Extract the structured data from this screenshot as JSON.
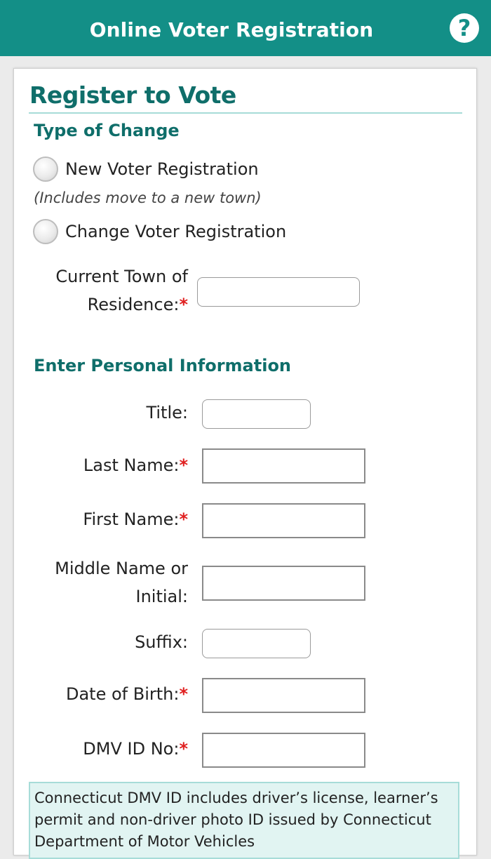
{
  "header": {
    "title": "Online Voter Registration",
    "help_icon": "question-mark-icon",
    "help_label": "?",
    "color": "#138f87"
  },
  "form": {
    "title": "Register to Vote",
    "type_of_change": {
      "heading": "Type of Change",
      "options": [
        {
          "label": "New Voter Registration",
          "checked": false
        },
        {
          "label": "Change Voter Registration",
          "checked": false
        }
      ],
      "note": "(Includes move to a new town)"
    },
    "current_town": {
      "label_line1": "Current Town of",
      "label_line2": "Residence:",
      "required_mark": "*",
      "value": ""
    },
    "personal": {
      "heading": "Enter Personal Information",
      "title_label": "Title:",
      "last_name_label": "Last Name:",
      "first_name_label": "First Name:",
      "middle_label_line1": "Middle Name or",
      "middle_label_line2": "Initial:",
      "suffix_label": "Suffix:",
      "dob_label": "Date of Birth:",
      "dmv_label": "DMV ID No:",
      "required_mark": "*"
    },
    "info_text": "Connecticut DMV ID includes driver’s license, learner’s permit and non-driver photo ID issued by Connecticut Department of Motor Vehicles"
  },
  "colors": {
    "accent": "#138f87",
    "heading": "#0f6e6a",
    "required": "#e02020",
    "info_bg": "#e1f4f2"
  }
}
